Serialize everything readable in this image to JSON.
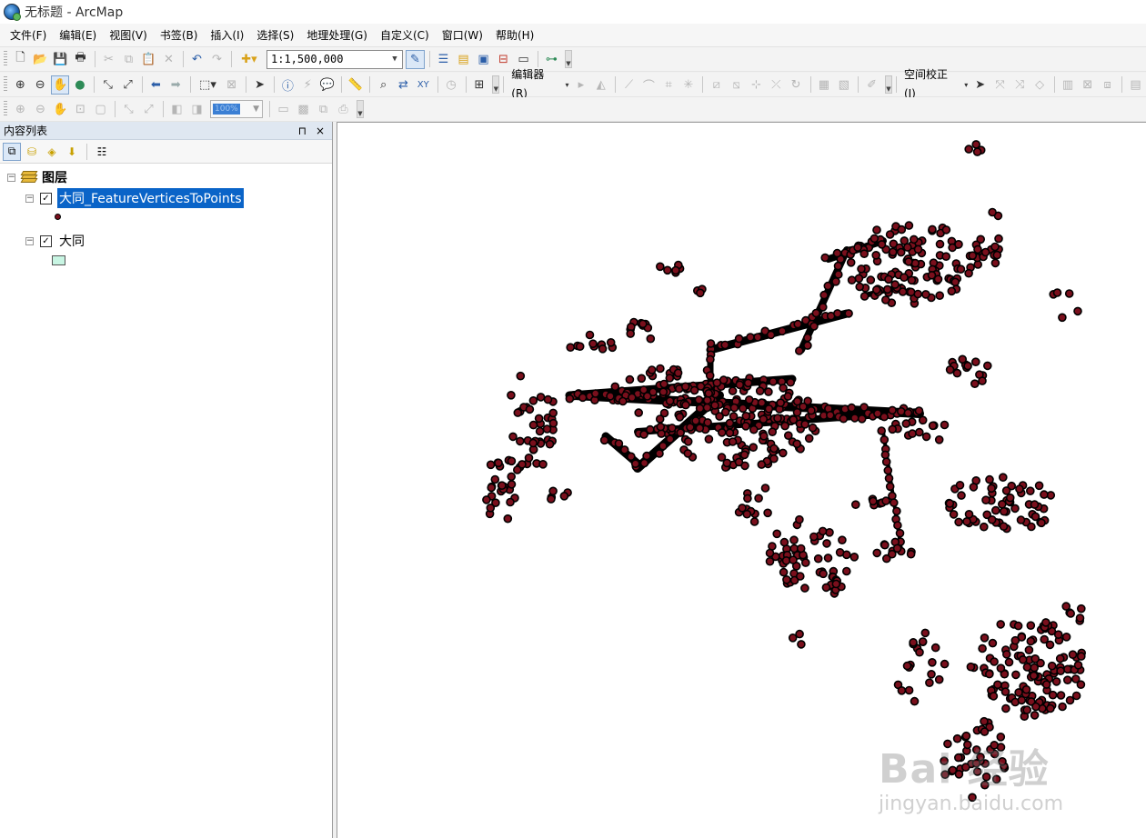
{
  "window": {
    "title": "无标题 - ArcMap"
  },
  "menu": [
    "文件(F)",
    "编辑(E)",
    "视图(V)",
    "书签(B)",
    "插入(I)",
    "选择(S)",
    "地理处理(G)",
    "自定义(C)",
    "窗口(W)",
    "帮助(H)"
  ],
  "toolbar": {
    "scale_value": "1:1,500,000",
    "editor_label": "编辑器(R)",
    "spatial_adjust_label": "空间校正(J)",
    "zoom_value": "100%"
  },
  "toc": {
    "title": "内容列表",
    "pin_glyph": "⊓",
    "close_glyph": "×",
    "group_label": "图层",
    "layers": [
      {
        "name": "大同_FeatureVerticesToPoints",
        "checked": true,
        "selected": true,
        "symbol": "point",
        "symbol_color": "#7a0f1c"
      },
      {
        "name": "大同",
        "checked": true,
        "selected": false,
        "symbol": "polygon",
        "symbol_color": "#c8f5e3"
      }
    ]
  },
  "map": {
    "point_fill": "#7a0f1c",
    "point_outline": "#000000"
  },
  "watermark": {
    "line1": "Bai 经验",
    "line2": "jingyan.baidu.com"
  }
}
